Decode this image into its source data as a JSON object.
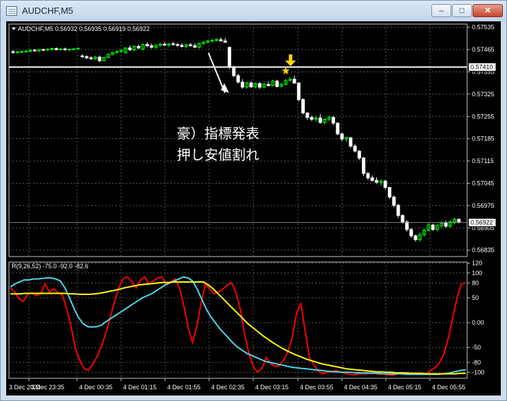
{
  "window": {
    "title": "AUDCHF,M5"
  },
  "colors": {
    "background": "#000000",
    "grid": "#5a5a5a",
    "frame": "#c8c8c8",
    "text": "#ffffff",
    "bull": "#00ff00",
    "bear": "#ffffff",
    "line_price": "#ffffff",
    "signal_star": "#ffd700",
    "signal_arrow": "#ffd700",
    "ind_red": "#ff0000",
    "ind_cyan": "#4fd6f0",
    "ind_yellow": "#ffff00"
  },
  "chart_data": [
    {
      "type": "candlestick",
      "symbol": "AUDCHF",
      "timeframe": "M5",
      "header": "AUDCHF,M5  0.56932 0.56935 0.56919 0.56922",
      "ohlc": {
        "open": "0.56932",
        "high": "0.56935",
        "low": "0.56919",
        "close": "0.56922"
      },
      "ylim": [
        0.56815,
        0.57545
      ],
      "y_ticks": [
        "0.57535",
        "0.57465",
        "0.57395",
        "0.57325",
        "0.57255",
        "0.57185",
        "0.57115",
        "0.57045",
        "0.56975",
        "0.56905",
        "0.56835"
      ],
      "horizontal_line": {
        "value": 0.5741,
        "label": "0.57410"
      },
      "current_price_label": "0.56922",
      "current_price": 0.56922,
      "candles": [
        {
          "o": 0.57458,
          "h": 0.57463,
          "l": 0.57452,
          "c": 0.57456
        },
        {
          "o": 0.57456,
          "h": 0.5746,
          "l": 0.57451,
          "c": 0.57458
        },
        {
          "o": 0.57458,
          "h": 0.57462,
          "l": 0.57454,
          "c": 0.57459
        },
        {
          "o": 0.57459,
          "h": 0.57464,
          "l": 0.57455,
          "c": 0.5746
        },
        {
          "o": 0.5746,
          "h": 0.57466,
          "l": 0.57456,
          "c": 0.57463
        },
        {
          "o": 0.57463,
          "h": 0.57467,
          "l": 0.57458,
          "c": 0.57461
        },
        {
          "o": 0.57461,
          "h": 0.57466,
          "l": 0.57457,
          "c": 0.57465
        },
        {
          "o": 0.57465,
          "h": 0.57468,
          "l": 0.5746,
          "c": 0.57464
        },
        {
          "o": 0.57464,
          "h": 0.5747,
          "l": 0.5746,
          "c": 0.57466
        },
        {
          "o": 0.57466,
          "h": 0.57471,
          "l": 0.57463,
          "c": 0.57468
        },
        {
          "o": 0.57468,
          "h": 0.57472,
          "l": 0.57462,
          "c": 0.57465
        },
        {
          "o": 0.57465,
          "h": 0.5747,
          "l": 0.57461,
          "c": 0.57467
        },
        {
          "o": 0.57467,
          "h": 0.57471,
          "l": 0.57462,
          "c": 0.57464
        },
        {
          "o": 0.57464,
          "h": 0.57468,
          "l": 0.5746,
          "c": 0.57466
        },
        {
          "o": 0.57466,
          "h": 0.5747,
          "l": 0.57463,
          "c": 0.57467
        },
        {
          "o": 0.57467,
          "h": 0.57472,
          "l": 0.57464,
          "c": 0.57469
        },
        {
          "o": 0.57445,
          "h": 0.5745,
          "l": 0.57438,
          "c": 0.57443
        },
        {
          "o": 0.57443,
          "h": 0.57447,
          "l": 0.57435,
          "c": 0.57439
        },
        {
          "o": 0.57439,
          "h": 0.57444,
          "l": 0.57432,
          "c": 0.57436
        },
        {
          "o": 0.57436,
          "h": 0.57445,
          "l": 0.57432,
          "c": 0.57441
        },
        {
          "o": 0.57441,
          "h": 0.57446,
          "l": 0.57426,
          "c": 0.5743
        },
        {
          "o": 0.5743,
          "h": 0.57442,
          "l": 0.57428,
          "c": 0.5744
        },
        {
          "o": 0.5744,
          "h": 0.57452,
          "l": 0.57438,
          "c": 0.5745
        },
        {
          "o": 0.5745,
          "h": 0.57458,
          "l": 0.57446,
          "c": 0.57456
        },
        {
          "o": 0.57456,
          "h": 0.57462,
          "l": 0.57452,
          "c": 0.57459
        },
        {
          "o": 0.57459,
          "h": 0.57466,
          "l": 0.57455,
          "c": 0.57462
        },
        {
          "o": 0.57455,
          "h": 0.57472,
          "l": 0.57453,
          "c": 0.5747
        },
        {
          "o": 0.5747,
          "h": 0.57478,
          "l": 0.5746,
          "c": 0.57464
        },
        {
          "o": 0.57464,
          "h": 0.57478,
          "l": 0.5746,
          "c": 0.57475
        },
        {
          "o": 0.57475,
          "h": 0.5748,
          "l": 0.57466,
          "c": 0.5747
        },
        {
          "o": 0.57466,
          "h": 0.57484,
          "l": 0.57463,
          "c": 0.57481
        },
        {
          "o": 0.57481,
          "h": 0.57488,
          "l": 0.57472,
          "c": 0.57477
        },
        {
          "o": 0.57477,
          "h": 0.57484,
          "l": 0.57468,
          "c": 0.57472
        },
        {
          "o": 0.57472,
          "h": 0.57482,
          "l": 0.57466,
          "c": 0.57478
        },
        {
          "o": 0.57478,
          "h": 0.57486,
          "l": 0.57473,
          "c": 0.57482
        },
        {
          "o": 0.57482,
          "h": 0.57488,
          "l": 0.57476,
          "c": 0.57479
        },
        {
          "o": 0.57479,
          "h": 0.57485,
          "l": 0.57473,
          "c": 0.57483
        },
        {
          "o": 0.57483,
          "h": 0.5749,
          "l": 0.57477,
          "c": 0.57481
        },
        {
          "o": 0.57481,
          "h": 0.57486,
          "l": 0.57474,
          "c": 0.57478
        },
        {
          "o": 0.57478,
          "h": 0.57485,
          "l": 0.57471,
          "c": 0.57475
        },
        {
          "o": 0.57475,
          "h": 0.57483,
          "l": 0.57469,
          "c": 0.5748
        },
        {
          "o": 0.5748,
          "h": 0.57486,
          "l": 0.57474,
          "c": 0.57477
        },
        {
          "o": 0.57477,
          "h": 0.57484,
          "l": 0.57471,
          "c": 0.57472
        },
        {
          "o": 0.57472,
          "h": 0.57487,
          "l": 0.57468,
          "c": 0.57484
        },
        {
          "o": 0.57484,
          "h": 0.57492,
          "l": 0.57479,
          "c": 0.57488
        },
        {
          "o": 0.57488,
          "h": 0.57495,
          "l": 0.57484,
          "c": 0.57492
        },
        {
          "o": 0.57492,
          "h": 0.57499,
          "l": 0.57486,
          "c": 0.57494
        },
        {
          "o": 0.57494,
          "h": 0.57502,
          "l": 0.5749,
          "c": 0.57496
        },
        {
          "o": 0.57496,
          "h": 0.57503,
          "l": 0.5749,
          "c": 0.57492
        },
        {
          "o": 0.57492,
          "h": 0.57501,
          "l": 0.57486,
          "c": 0.57488
        },
        {
          "o": 0.57472,
          "h": 0.57474,
          "l": 0.57404,
          "c": 0.5741
        },
        {
          "o": 0.5741,
          "h": 0.57415,
          "l": 0.57378,
          "c": 0.57383
        },
        {
          "o": 0.57383,
          "h": 0.57389,
          "l": 0.57358,
          "c": 0.57363
        },
        {
          "o": 0.57363,
          "h": 0.57372,
          "l": 0.57342,
          "c": 0.57347
        },
        {
          "o": 0.57347,
          "h": 0.57364,
          "l": 0.57342,
          "c": 0.5736
        },
        {
          "o": 0.5736,
          "h": 0.57366,
          "l": 0.57344,
          "c": 0.57348
        },
        {
          "o": 0.57348,
          "h": 0.57362,
          "l": 0.57343,
          "c": 0.57358
        },
        {
          "o": 0.57358,
          "h": 0.57363,
          "l": 0.57342,
          "c": 0.57347
        },
        {
          "o": 0.57347,
          "h": 0.57361,
          "l": 0.57344,
          "c": 0.57356
        },
        {
          "o": 0.57356,
          "h": 0.57366,
          "l": 0.57349,
          "c": 0.57352
        },
        {
          "o": 0.57352,
          "h": 0.5737,
          "l": 0.57349,
          "c": 0.57366
        },
        {
          "o": 0.57366,
          "h": 0.5737,
          "l": 0.57346,
          "c": 0.57349
        },
        {
          "o": 0.57349,
          "h": 0.57361,
          "l": 0.57346,
          "c": 0.57356
        },
        {
          "o": 0.57356,
          "h": 0.57372,
          "l": 0.57353,
          "c": 0.57368
        },
        {
          "o": 0.57368,
          "h": 0.57378,
          "l": 0.57364,
          "c": 0.57372
        },
        {
          "o": 0.57372,
          "h": 0.57383,
          "l": 0.57357,
          "c": 0.5736
        },
        {
          "o": 0.5736,
          "h": 0.57362,
          "l": 0.57302,
          "c": 0.57308
        },
        {
          "o": 0.57308,
          "h": 0.57312,
          "l": 0.57262,
          "c": 0.57266
        },
        {
          "o": 0.57266,
          "h": 0.57268,
          "l": 0.57244,
          "c": 0.57252
        },
        {
          "o": 0.57252,
          "h": 0.57258,
          "l": 0.5724,
          "c": 0.57246
        },
        {
          "o": 0.57246,
          "h": 0.57256,
          "l": 0.57238,
          "c": 0.5725
        },
        {
          "o": 0.5725,
          "h": 0.57262,
          "l": 0.57232,
          "c": 0.57236
        },
        {
          "o": 0.57236,
          "h": 0.5725,
          "l": 0.5723,
          "c": 0.57246
        },
        {
          "o": 0.57246,
          "h": 0.57258,
          "l": 0.5724,
          "c": 0.57252
        },
        {
          "o": 0.57252,
          "h": 0.57256,
          "l": 0.57228,
          "c": 0.57234
        },
        {
          "o": 0.57234,
          "h": 0.57236,
          "l": 0.57196,
          "c": 0.572
        },
        {
          "o": 0.572,
          "h": 0.57204,
          "l": 0.57178,
          "c": 0.57184
        },
        {
          "o": 0.57184,
          "h": 0.57192,
          "l": 0.57176,
          "c": 0.57188
        },
        {
          "o": 0.57188,
          "h": 0.5719,
          "l": 0.57156,
          "c": 0.57162
        },
        {
          "o": 0.57162,
          "h": 0.57168,
          "l": 0.57142,
          "c": 0.57146
        },
        {
          "o": 0.57146,
          "h": 0.5715,
          "l": 0.57118,
          "c": 0.57124
        },
        {
          "o": 0.57124,
          "h": 0.57128,
          "l": 0.57068,
          "c": 0.57076
        },
        {
          "o": 0.57076,
          "h": 0.5708,
          "l": 0.57056,
          "c": 0.57062
        },
        {
          "o": 0.57062,
          "h": 0.5707,
          "l": 0.5705,
          "c": 0.57054
        },
        {
          "o": 0.57054,
          "h": 0.57064,
          "l": 0.57044,
          "c": 0.57048
        },
        {
          "o": 0.57048,
          "h": 0.57058,
          "l": 0.57038,
          "c": 0.57052
        },
        {
          "o": 0.57052,
          "h": 0.57056,
          "l": 0.57026,
          "c": 0.57032
        },
        {
          "o": 0.57032,
          "h": 0.57034,
          "l": 0.56996,
          "c": 0.57002
        },
        {
          "o": 0.57002,
          "h": 0.57006,
          "l": 0.5697,
          "c": 0.56976
        },
        {
          "o": 0.56976,
          "h": 0.5698,
          "l": 0.56936,
          "c": 0.56944
        },
        {
          "o": 0.56944,
          "h": 0.56948,
          "l": 0.56918,
          "c": 0.56924
        },
        {
          "o": 0.56924,
          "h": 0.56928,
          "l": 0.56894,
          "c": 0.569
        },
        {
          "o": 0.569,
          "h": 0.56904,
          "l": 0.56874,
          "c": 0.5688
        },
        {
          "o": 0.5688,
          "h": 0.56884,
          "l": 0.56862,
          "c": 0.56868
        },
        {
          "o": 0.56868,
          "h": 0.5689,
          "l": 0.56862,
          "c": 0.56884
        },
        {
          "o": 0.56884,
          "h": 0.56904,
          "l": 0.56878,
          "c": 0.56898
        },
        {
          "o": 0.56898,
          "h": 0.56922,
          "l": 0.56892,
          "c": 0.56914
        },
        {
          "o": 0.56914,
          "h": 0.56918,
          "l": 0.56896,
          "c": 0.569
        },
        {
          "o": 0.569,
          "h": 0.56918,
          "l": 0.56894,
          "c": 0.56912
        },
        {
          "o": 0.56912,
          "h": 0.56926,
          "l": 0.56904,
          "c": 0.5692
        },
        {
          "o": 0.5692,
          "h": 0.56928,
          "l": 0.56906,
          "c": 0.5691
        },
        {
          "o": 0.5691,
          "h": 0.56928,
          "l": 0.56906,
          "c": 0.56924
        },
        {
          "o": 0.56924,
          "h": 0.56936,
          "l": 0.56916,
          "c": 0.56932
        },
        {
          "o": 0.56932,
          "h": 0.56935,
          "l": 0.56919,
          "c": 0.56922
        }
      ],
      "signal": {
        "candle_index": 63,
        "marker": "star",
        "arrow": "down"
      },
      "annotation_lines": [
        "豪）指標発表",
        "押し安値割れ"
      ]
    },
    {
      "type": "line",
      "header": "R(9,26,52) -75.0 -92.0 -82.6",
      "ylim": [
        -112,
        122
      ],
      "y_ticks": [
        "120",
        "100",
        "80",
        "50",
        "0.00",
        "-50",
        "-80",
        "-100"
      ],
      "series": [
        {
          "values": [
            70,
            62,
            48,
            43,
            57,
            60,
            55,
            58,
            78,
            62,
            68,
            60,
            56,
            28,
            -8,
            -52,
            -76,
            -92,
            -96,
            -84,
            -68,
            -48,
            -22,
            10,
            42,
            70,
            88,
            92,
            83,
            70,
            86,
            92,
            78,
            84,
            90,
            92,
            76,
            82,
            88,
            70,
            35,
            -10,
            -40,
            -8,
            40,
            77,
            68,
            58,
            62,
            67,
            76,
            80,
            62,
            28,
            -22,
            -62,
            -88,
            -100,
            -92,
            -70,
            -82,
            -88,
            -86,
            -76,
            -58,
            -30,
            20,
            38,
            -18,
            -72,
            -85,
            -97,
            -103,
            -100,
            -99,
            -96,
            -99,
            -101,
            -103,
            -105,
            -104,
            -102,
            -103,
            -100,
            -101,
            -104,
            -103,
            -105,
            -106,
            -104,
            -101,
            -104,
            -102,
            -103,
            -104,
            -103,
            -102,
            -96,
            -90,
            -80,
            -62,
            -30,
            10,
            50,
            78,
            80
          ]
        },
        {
          "values": [
            72,
            78,
            82,
            86,
            86,
            88,
            88,
            89,
            90,
            90,
            88,
            84,
            70,
            50,
            28,
            10,
            -2,
            -8,
            -9,
            -8,
            -5,
            2,
            8,
            14,
            20,
            26,
            32,
            38,
            44,
            50,
            54,
            58,
            64,
            70,
            76,
            80,
            84,
            88,
            92,
            90,
            84,
            68,
            48,
            28,
            12,
            0,
            -12,
            -22,
            -32,
            -42,
            -50,
            -56,
            -62,
            -66,
            -70,
            -74,
            -78,
            -80,
            -82,
            -84,
            -86,
            -88,
            -90,
            -91,
            -92,
            -93,
            -94,
            -95,
            -96,
            -97,
            -98,
            -99,
            -99,
            -100,
            -100,
            -100,
            -101,
            -101,
            -101,
            -102,
            -102,
            -102,
            -103,
            -103,
            -103,
            -103,
            -103,
            -104,
            -104,
            -104,
            -104,
            -104,
            -104,
            -104,
            -104,
            -103,
            -102,
            -100,
            -98,
            -96,
            -95
          ]
        },
        {
          "values": [
            58,
            58,
            58,
            59,
            59,
            59,
            59,
            59,
            59,
            59,
            59,
            59,
            58,
            58,
            57,
            57,
            57,
            58,
            59,
            61,
            63,
            65,
            67,
            70,
            72,
            74,
            76,
            77,
            78,
            79,
            80,
            81,
            81,
            82,
            82,
            82,
            82,
            82,
            82,
            82,
            76,
            68,
            58,
            48,
            38,
            28,
            18,
            8,
            -2,
            -10,
            -18,
            -26,
            -33,
            -40,
            -46,
            -52,
            -57,
            -62,
            -66,
            -70,
            -74,
            -77,
            -80,
            -83,
            -85,
            -87,
            -89,
            -91,
            -93,
            -94,
            -95,
            -96,
            -97,
            -98,
            -99,
            -99,
            -100,
            -100,
            -101,
            -101,
            -101,
            -102,
            -102,
            -102,
            -103,
            -103,
            -103,
            -103,
            -103,
            -103,
            -103,
            -102,
            -102
          ]
        }
      ]
    }
  ],
  "time_axis": {
    "labels": [
      "3 Dec 2024",
      "3 Dec 23:35",
      "4 Dec 00:35",
      "4 Dec 01:15",
      "4 Dec 01:55",
      "4 Dec 02:35",
      "4 Dec 03:15",
      "4 Dec 03:55",
      "4 Dec 04:35",
      "4 Dec 05:15",
      "4 Dec 05:55"
    ]
  }
}
